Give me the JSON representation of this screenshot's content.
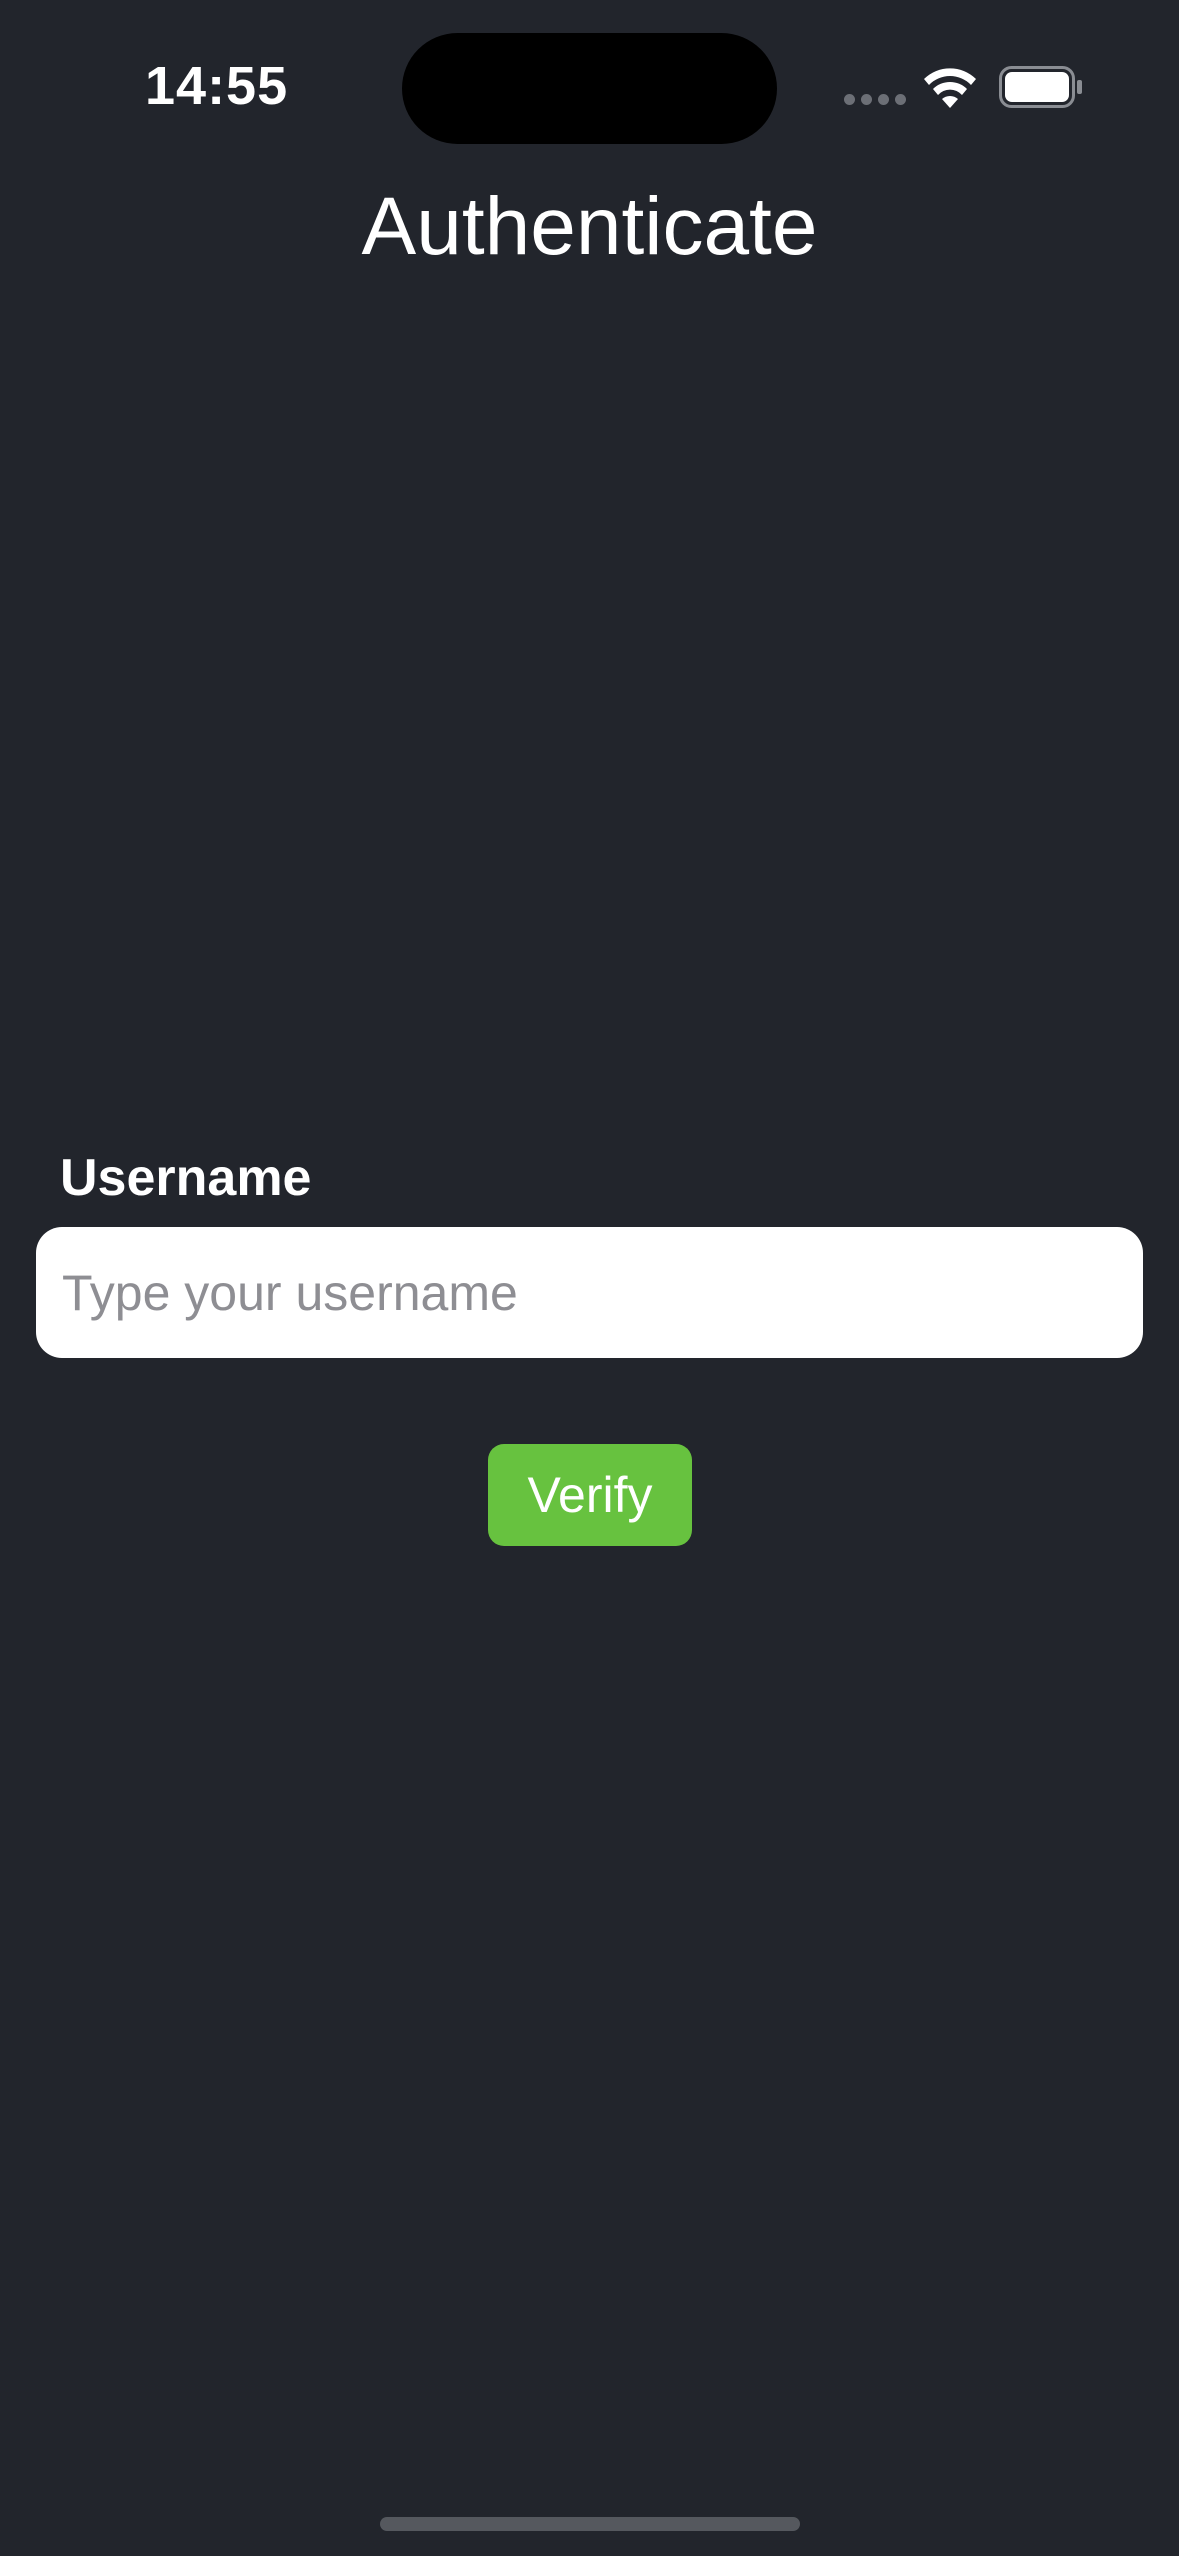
{
  "status_bar": {
    "time": "14:55",
    "icons": [
      "cellular-signal-icon",
      "wifi-icon",
      "battery-icon"
    ]
  },
  "header": {
    "title": "Authenticate"
  },
  "form": {
    "username_label": "Username",
    "username_value": "",
    "username_placeholder": "Type your username",
    "verify_label": "Verify"
  },
  "colors": {
    "background": "#22252c",
    "accent_button": "#67c23f",
    "input_background": "#ffffff",
    "placeholder": "#8e8e93"
  }
}
